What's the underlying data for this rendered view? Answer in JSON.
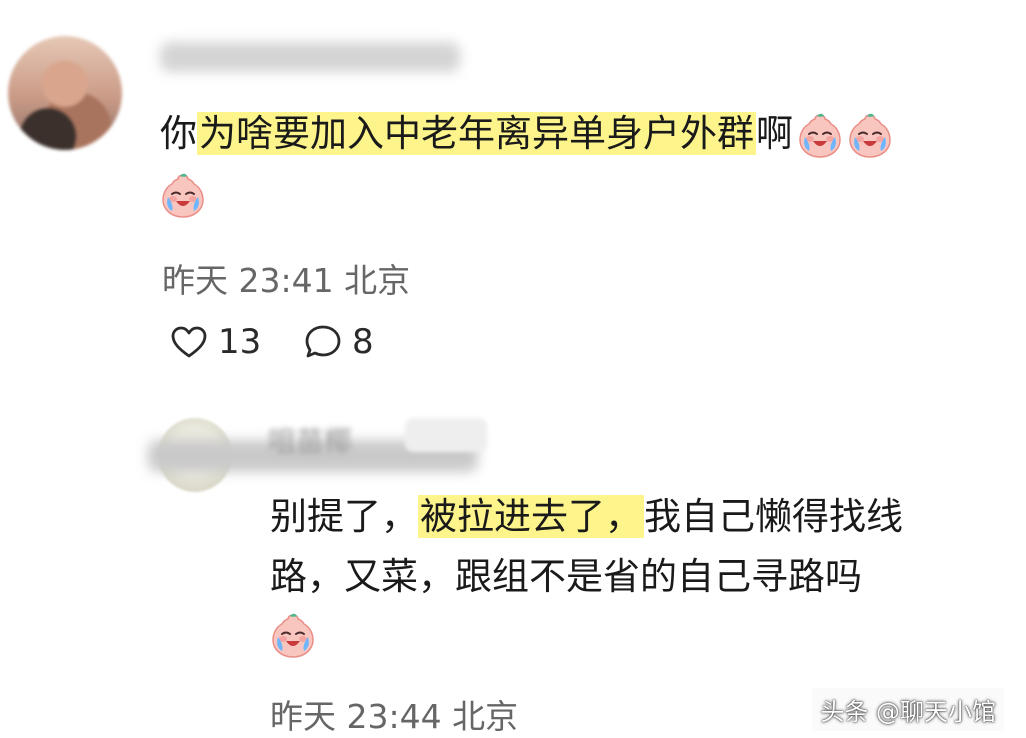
{
  "main_comment": {
    "line1_prefix": "你",
    "line1_highlight": "为啥要加入中老年离异单身户外群",
    "line1_suffix": "啊",
    "meta": "昨天 23:41 北京",
    "likes": "13",
    "replies": "8"
  },
  "reply": {
    "name": "咀苗椰",
    "line1_prefix": "别提了，",
    "line1_highlight": "被拉进去了，",
    "line1_suffix": "我自己懒得找线",
    "line2": "路，又菜，跟组不是省的自己寻路吗",
    "meta": "昨天 23:44 北京"
  },
  "watermark": "头条 @聊天小馆",
  "emoji": {
    "icon": "crying-face-emoji",
    "color": "#f6b6b0"
  },
  "colors": {
    "highlight": "#fdf58c",
    "meta": "#666666"
  }
}
